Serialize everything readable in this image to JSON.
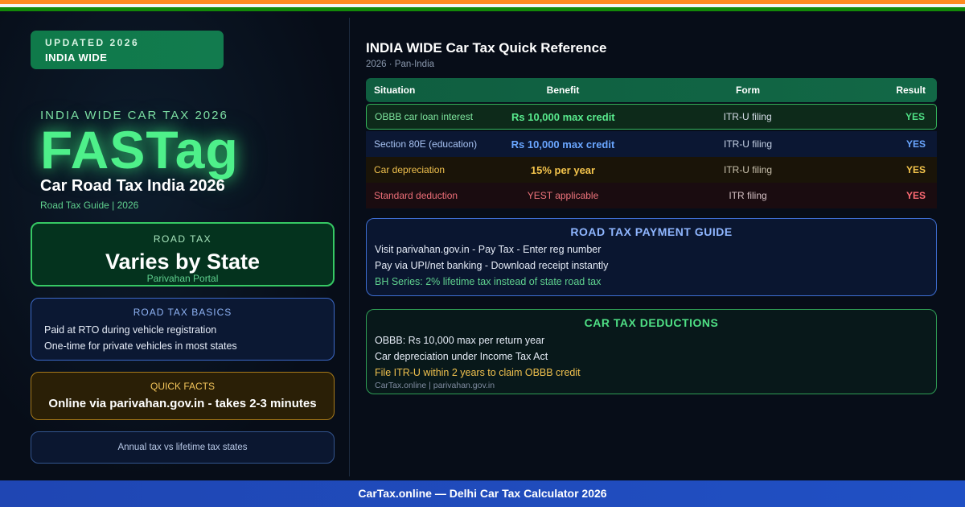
{
  "colors": {
    "accent_green": "#4ef08a",
    "accent_blue": "#6aa6ff",
    "accent_amber": "#f4c44c",
    "accent_red": "#ff6b74",
    "footer_blue": "#2050c4",
    "flag_saffron": "#ff8a1f",
    "flag_green": "#138808"
  },
  "badge": {
    "line1": "UPDATED 2026",
    "line2": "INDIA WIDE"
  },
  "hero": {
    "kicker": "INDIA WIDE CAR TAX 2026",
    "title": "FASTag",
    "subtitle": "Car Road Tax India 2026",
    "caption": "Road Tax Guide | 2026"
  },
  "road_tax_card": {
    "label": "ROAD TAX",
    "value": "Varies by State",
    "caption": "Parivahan Portal"
  },
  "basics_card": {
    "label": "ROAD TAX BASICS",
    "lines": [
      "Paid at RTO during vehicle registration",
      "One-time for private vehicles in most states"
    ]
  },
  "quick_facts": {
    "label": "QUICK FACTS",
    "value": "Online via parivahan.gov.in - takes 2-3 minutes"
  },
  "note_card": {
    "text": "Annual tax vs lifetime tax states"
  },
  "reference": {
    "title": "INDIA WIDE Car Tax Quick Reference",
    "subtitle": "2026 · Pan-India",
    "headers": [
      "Situation",
      "Benefit",
      "Form",
      "Result"
    ],
    "rows": [
      {
        "situation": "OBBB car loan interest",
        "benefit": "Rs 10,000 max credit",
        "form": "ITR-U filing",
        "result": "YES"
      },
      {
        "situation": "Section 80E (education)",
        "benefit": "Rs 10,000 max credit",
        "form": "ITR-U filing",
        "result": "YES"
      },
      {
        "situation": "Car depreciation",
        "benefit": "15% per year",
        "form": "ITR-U filing",
        "result": "YES"
      },
      {
        "situation": "Standard deduction",
        "benefit": "YEST applicable",
        "form": "ITR filing",
        "result": "YES"
      }
    ]
  },
  "payment_guide": {
    "title": "ROAD TAX PAYMENT GUIDE",
    "lines": [
      "Visit parivahan.gov.in - Pay Tax - Enter reg number",
      "Pay via UPI/net banking - Download receipt instantly",
      "BH Series: 2% lifetime tax instead of state road tax"
    ]
  },
  "deductions": {
    "title": "CAR TAX DEDUCTIONS",
    "lines": [
      "OBBB: Rs 10,000 max per return year",
      "Car depreciation under Income Tax Act",
      "File ITR-U within 2 years to claim OBBB credit"
    ],
    "source": "CarTax.online | parivahan.gov.in"
  },
  "footer": {
    "text": "CarTax.online — Delhi Car Tax Calculator 2026"
  }
}
